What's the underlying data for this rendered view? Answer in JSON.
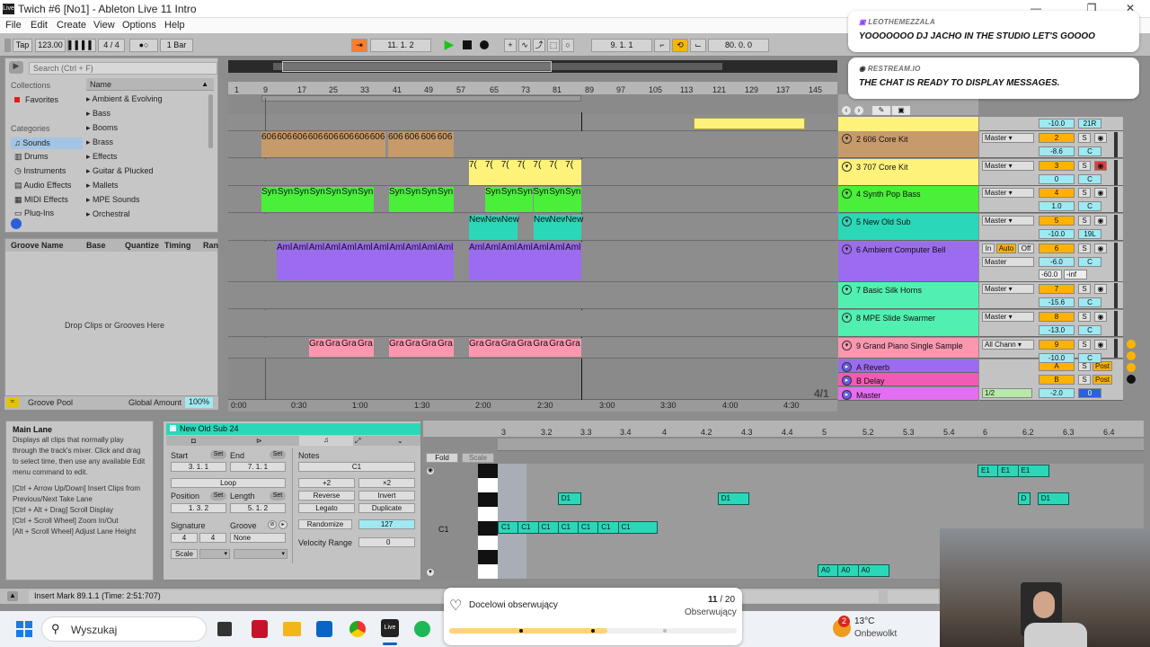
{
  "window": {
    "title": "Twich #6  [No1] - Ableton Live 11 Intro",
    "app_icon": "Live"
  },
  "menu": [
    "File",
    "Edit",
    "Create",
    "View",
    "Options",
    "Help"
  ],
  "control_bar": {
    "tap": "Tap",
    "tempo": "123.00",
    "time_signature": "4 / 4",
    "metro": "●○",
    "quantize": "1 Bar",
    "arrangement_position": "11.  1.  2",
    "loop_start": "9.  1.  1",
    "loop_length": "80.  0.  0"
  },
  "browser": {
    "search_placeholder": "Search (Ctrl + F)",
    "collections_label": "Collections",
    "favorites": "Favorites",
    "categories_label": "Categories",
    "categories": [
      "Sounds",
      "Drums",
      "Instruments",
      "Audio Effects",
      "MIDI Effects",
      "Plug-Ins"
    ],
    "name_header": "Name",
    "items": [
      "Ambient & Evolving",
      "Bass",
      "Booms",
      "Brass",
      "Effects",
      "Guitar & Plucked",
      "Mallets",
      "MPE Sounds",
      "Orchestral"
    ]
  },
  "groove": {
    "headers": [
      "Groove Name",
      "Base",
      "Quantize",
      "Timing",
      "Ran"
    ],
    "drop_text": "Drop Clips or Grooves Here",
    "pool_label": "Groove Pool",
    "global_amount_label": "Global Amount",
    "global_amount": "100%"
  },
  "ruler": {
    "bars": [
      "1",
      "9",
      "17",
      "25",
      "33",
      "41",
      "49",
      "57",
      "65",
      "73",
      "81",
      "89",
      "97",
      "105",
      "113",
      "121",
      "129",
      "137",
      "145"
    ],
    "times": [
      "0:00",
      "0:30",
      "1:00",
      "1:30",
      "2:00",
      "2:30",
      "3:00",
      "3:30",
      "4:00",
      "4:30"
    ],
    "zoom": "4/1"
  },
  "tracks": [
    {
      "num": "2",
      "name": "2 606 Core Kit",
      "color": "#c79a6a",
      "routing": "Master",
      "vol": "-8.6",
      "pan": "C",
      "clip_label": "606"
    },
    {
      "num": "3",
      "name": "3 707 Core Kit",
      "color": "#fff27a",
      "routing": "Master",
      "vol": "0",
      "pan": "C",
      "clip_label": "7("
    },
    {
      "num": "4",
      "name": "4 Synth Pop Bass",
      "color": "#4aef3a",
      "routing": "Master",
      "vol": "1.0",
      "pan": "C",
      "clip_label": "Syn"
    },
    {
      "num": "5",
      "name": "5 New Old Sub",
      "color": "#2ad8b8",
      "routing": "Master",
      "vol": "-10.0",
      "pan": "19L",
      "clip_label": "New"
    },
    {
      "num": "6",
      "name": "6 Ambient Computer Bell",
      "color": "#9b6bf0",
      "routing": "Master",
      "vol": "-6.0",
      "pan": "C",
      "clip_label": "Aml",
      "extra": "-60.0",
      "extra2": "-inf"
    },
    {
      "num": "7",
      "name": "7 Basic Silk Horns",
      "color": "#52f0b0",
      "routing": "Master",
      "vol": "-15.6",
      "pan": "C"
    },
    {
      "num": "8",
      "name": "8 MPE Slide Swarmer",
      "color": "#52f0b0",
      "routing": "Master",
      "vol": "-13.0",
      "pan": "C"
    },
    {
      "num": "9",
      "name": "9 Grand Piano Single Sample",
      "color": "#ff96b0",
      "routing": "All Chann",
      "vol": "-10.0",
      "pan": "C",
      "clip_label": "Gra"
    }
  ],
  "top_track": {
    "vol": "-10.0",
    "pan": "21R"
  },
  "returns": [
    {
      "letter": "A",
      "name": "A Reverb",
      "color": "#9b6bf0",
      "post": "Post"
    },
    {
      "letter": "B",
      "name": "B Delay",
      "color": "#f25bb5",
      "post": "Post"
    }
  ],
  "master": {
    "name": "Master",
    "color": "#e56df0",
    "cue": "1/2",
    "vol": "-2.0",
    "pan": "0"
  },
  "auto_labels": {
    "in": "In",
    "auto": "Auto",
    "off": "Off"
  },
  "info_view": {
    "title": "Main Lane",
    "text": "Displays all clips that normally play through the track's mixer. Click and drag to select time, then use any available Edit menu command to edit.",
    "shortcuts": [
      "[Ctrl + Arrow Up/Down] Insert Clips from Previous/Next Take Lane",
      "[Ctrl + Alt + Drag] Scroll Display",
      "[Ctrl + Scroll Wheel] Zoom In/Out",
      "[Alt + Scroll Wheel] Adjust Lane Height"
    ]
  },
  "clip_view": {
    "name": "New Old Sub 24",
    "start_label": "Start",
    "end_label": "End",
    "set": "Set",
    "start": "3.   1.   1",
    "end": "7.   1.   1",
    "loop": "Loop",
    "position_label": "Position",
    "length_label": "Length",
    "position": "1.   3.   2",
    "length": "5.   1.   2",
    "signature_label": "Signature",
    "groove_label": "Groove",
    "sig_num": "4",
    "sig_den": "4",
    "groove": "None",
    "scale": "Scale",
    "notes_label": "Notes",
    "note": "C1",
    "plus2": "+2",
    "times2": "×2",
    "reverse": "Reverse",
    "invert": "Invert",
    "legato": "Legato",
    "duplicate": "Duplicate",
    "randomize": "Randomize",
    "randomize_val": "127",
    "velocity_range": "Velocity Range",
    "velocity_val": "0"
  },
  "piano_roll": {
    "fold": "Fold",
    "scale": "Scale",
    "key_label": "C1",
    "ruler": [
      "3",
      "3.2",
      "3.3",
      "3.4",
      "4",
      "4.2",
      "4.3",
      "4.4",
      "5",
      "5.2",
      "5.3",
      "5.4",
      "6",
      "6.2",
      "6.3",
      "6.4"
    ],
    "notes": [
      {
        "pitch": "E1",
        "row": 0,
        "start": 6.0,
        "len": 0.2
      },
      {
        "pitch": "E1",
        "row": 0,
        "start": 6.125,
        "len": 0.2
      },
      {
        "pitch": "E1",
        "row": 0,
        "start": 6.25,
        "len": 0.2
      },
      {
        "pitch": "D1",
        "row": 1,
        "start": 3.375,
        "len": 0.15
      },
      {
        "pitch": "D1",
        "row": 1,
        "start": 4.375,
        "len": 0.2
      },
      {
        "pitch": "D",
        "row": 1,
        "start": 6.25,
        "len": 0.05
      },
      {
        "pitch": "D1",
        "row": 1,
        "start": 6.375,
        "len": 0.2
      },
      {
        "pitch": "C1",
        "row": 2,
        "start": 3.0,
        "len": 0.2
      },
      {
        "pitch": "C1",
        "row": 2,
        "start": 3.125,
        "len": 0.2
      },
      {
        "pitch": "C1",
        "row": 2,
        "start": 3.25,
        "len": 0.2
      },
      {
        "pitch": "C1",
        "row": 2,
        "start": 3.375,
        "len": 0.2
      },
      {
        "pitch": "C1",
        "row": 2,
        "start": 3.5,
        "len": 0.2
      },
      {
        "pitch": "C1",
        "row": 2,
        "start": 3.625,
        "len": 0.2
      },
      {
        "pitch": "C1",
        "row": 2,
        "start": 3.75,
        "len": 0.25
      },
      {
        "pitch": "A0",
        "row": 3,
        "start": 5.0,
        "len": 0.2
      },
      {
        "pitch": "A0",
        "row": 3,
        "start": 5.125,
        "len": 0.2
      },
      {
        "pitch": "A0",
        "row": 3,
        "start": 5.25,
        "len": 0.2
      }
    ]
  },
  "status": "Insert Mark 89.1.1 (Time: 2:51:707)",
  "chat": [
    {
      "user": "LEOTHEMEZZALA",
      "message": "YOOOOOOO DJ JACHO IN THE STUDIO LET'S GOOOO"
    },
    {
      "user": "RESTREAM.IO",
      "message": "THE CHAT IS READY TO DISPLAY MESSAGES."
    }
  ],
  "follower_goal": {
    "label": "Docelowi obserwujący",
    "current": "11",
    "target": "20",
    "caption": "Obserwujący",
    "fraction": 0.55
  },
  "taskbar": {
    "search_placeholder": "Wyszukaj",
    "weather_temp": "13°C",
    "weather_text": "Onbewolkt",
    "weather_badge": "2"
  }
}
